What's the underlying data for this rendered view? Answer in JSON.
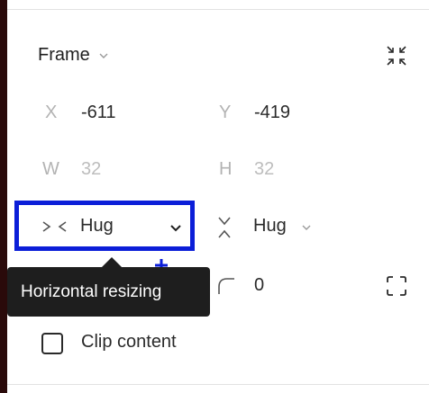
{
  "panel": {
    "section_title": "Frame",
    "position": {
      "x_label": "X",
      "x_value": "-611",
      "y_label": "Y",
      "y_value": "-419"
    },
    "size": {
      "w_label": "W",
      "w_value": "32",
      "h_label": "H",
      "h_value": "32"
    },
    "resizing": {
      "horizontal_value": "Hug",
      "vertical_value": "Hug"
    },
    "corner_radius_value": "0",
    "clip_content": {
      "label": "Clip content",
      "checked": false
    }
  },
  "tooltip": {
    "text": "Horizontal resizing"
  },
  "colors": {
    "highlight_border": "#0b1ed8",
    "tooltip_bg": "#1e1e1e",
    "muted_text": "#b3b3b3"
  },
  "icons": [
    "chevron-down-icon",
    "collapse-icon",
    "horizontal-resize-icon",
    "vertical-resize-icon",
    "corner-radius-icon",
    "independent-corners-icon",
    "plus-icon"
  ]
}
